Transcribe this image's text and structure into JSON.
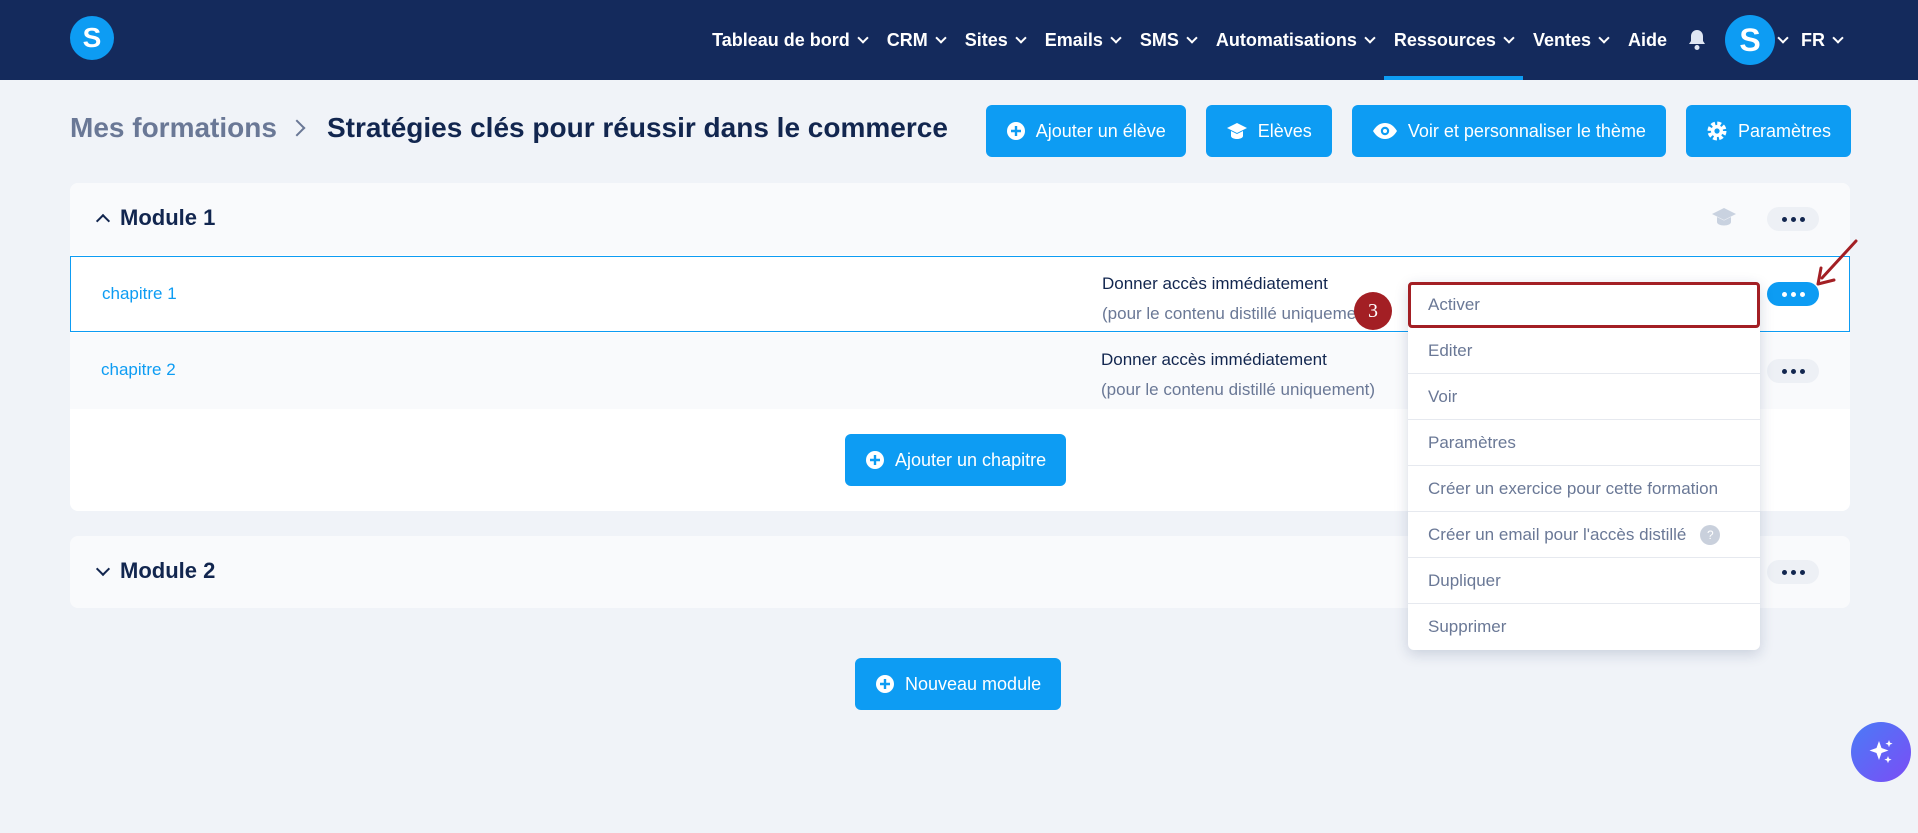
{
  "nav": {
    "items": [
      {
        "label": "Tableau de bord",
        "has_caret": true
      },
      {
        "label": "CRM",
        "has_caret": true
      },
      {
        "label": "Sites",
        "has_caret": true
      },
      {
        "label": "Emails",
        "has_caret": true
      },
      {
        "label": "SMS",
        "has_caret": true
      },
      {
        "label": "Automatisations",
        "has_caret": true
      },
      {
        "label": "Ressources",
        "has_caret": true,
        "active": true
      },
      {
        "label": "Ventes",
        "has_caret": true
      },
      {
        "label": "Aide",
        "has_caret": false
      }
    ],
    "logo_letter": "S",
    "avatar_letter": "S",
    "language": "FR"
  },
  "breadcrumb": {
    "parent": "Mes formations",
    "current": "Stratégies clés pour réussir dans le commerce"
  },
  "header_buttons": {
    "add_student": "Ajouter un élève",
    "students": "Elèves",
    "theme": "Voir et personnaliser le thème",
    "settings": "Paramètres"
  },
  "modules": [
    {
      "title": "Module 1",
      "expanded": true,
      "chapters": [
        {
          "name": "chapitre 1",
          "access": "Donner accès immédiatement",
          "access_sub": "(pour le contenu distillé uniquement)",
          "selected": true
        },
        {
          "name": "chapitre 2",
          "access": "Donner accès immédiatement",
          "access_sub": "(pour le contenu distillé uniquement)",
          "selected": false
        }
      ],
      "add_chapter_label": "Ajouter un chapitre"
    },
    {
      "title": "Module 2",
      "expanded": false
    }
  ],
  "new_module_label": "Nouveau module",
  "dropdown": {
    "items": [
      "Activer",
      "Editer",
      "Voir",
      "Paramètres",
      "Créer un exercice pour cette formation",
      "Créer un email pour l'accès distillé",
      "Dupliquer",
      "Supprimer"
    ],
    "help_glyph": "?"
  },
  "annotation": {
    "step": "3"
  },
  "colors": {
    "nav_bg": "#142a5c",
    "accent": "#0d9cf3",
    "highlight": "#a31f24",
    "page_bg": "#f0f3f8"
  }
}
